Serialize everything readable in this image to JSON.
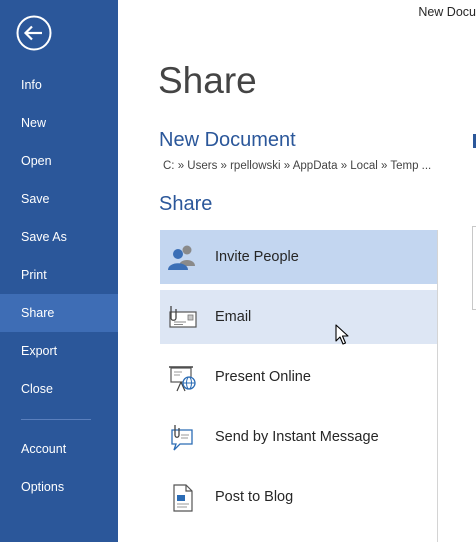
{
  "window": {
    "title": "New Docu"
  },
  "sidebar": {
    "back_icon": "back-arrow-icon",
    "items": [
      {
        "label": "Info"
      },
      {
        "label": "New"
      },
      {
        "label": "Open"
      },
      {
        "label": "Save"
      },
      {
        "label": "Save As"
      },
      {
        "label": "Print"
      },
      {
        "label": "Share",
        "active": true
      },
      {
        "label": "Export"
      },
      {
        "label": "Close"
      },
      {
        "label": "Account"
      },
      {
        "label": "Options"
      }
    ]
  },
  "main": {
    "title": "Share",
    "document_name": "New Document",
    "document_path": "C: » Users » rpellowski » AppData » Local » Temp ...",
    "section_title": "Share",
    "options": [
      {
        "label": "Invite People",
        "icon": "people-icon",
        "state": "selected"
      },
      {
        "label": "Email",
        "icon": "email-icon",
        "state": "hover"
      },
      {
        "label": "Present Online",
        "icon": "present-online-icon",
        "state": "normal"
      },
      {
        "label": "Send by Instant Message",
        "icon": "instant-message-icon",
        "state": "normal"
      },
      {
        "label": "Post to Blog",
        "icon": "blog-icon",
        "state": "normal"
      }
    ]
  },
  "colors": {
    "sidebar": "#2b579a",
    "sidebar_active": "#3e6db5",
    "accent_text": "#2b579a",
    "option_selected": "#c3d6f0",
    "option_hover": "#dde6f4"
  }
}
